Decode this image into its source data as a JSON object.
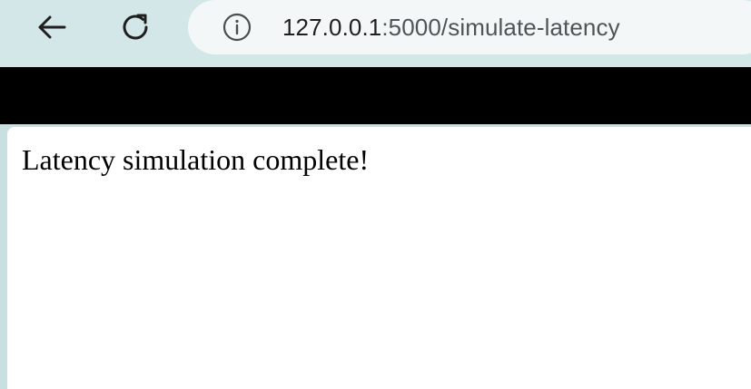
{
  "browser": {
    "address_bar": {
      "host": "127.0.0.1",
      "path": ":5000/simulate-latency"
    },
    "icons": {
      "back": "back-arrow-icon",
      "reload": "reload-icon",
      "info": "info-icon"
    }
  },
  "page": {
    "message": "Latency simulation complete!"
  }
}
